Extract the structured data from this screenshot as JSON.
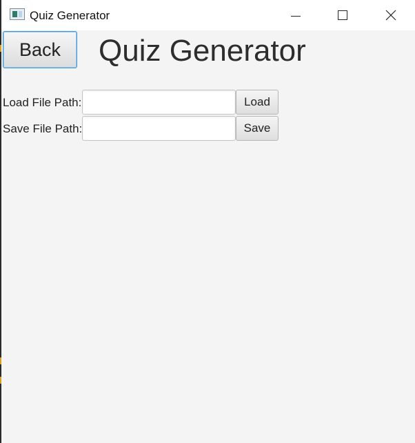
{
  "window": {
    "title": "Quiz Generator",
    "controls": {
      "minimize": "minimize-icon",
      "maximize": "maximize-icon",
      "close": "close-icon"
    }
  },
  "header": {
    "back_label": "Back",
    "title": "Quiz Generator"
  },
  "load": {
    "label": "Load File Path:",
    "value": "",
    "placeholder": "",
    "button_label": "Load"
  },
  "save": {
    "label": "Save File Path:",
    "value": "",
    "placeholder": "",
    "button_label": "Save"
  },
  "colors": {
    "background": "#f4f4f4",
    "titlebar": "#ffffff",
    "focus_border": "#3b99e0",
    "text": "#222222"
  }
}
